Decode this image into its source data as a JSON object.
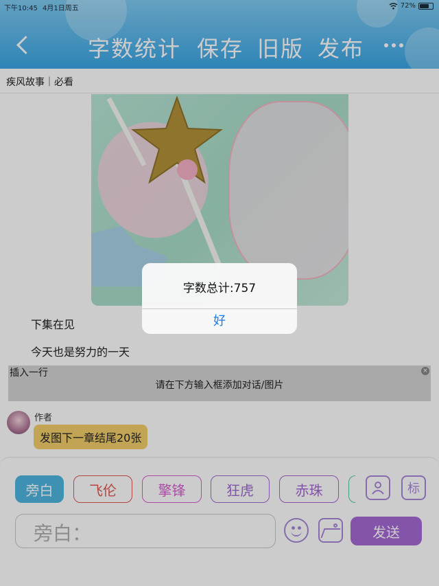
{
  "status_bar": {
    "time": "下午10:45",
    "date": "4月1日周五",
    "battery": "72%",
    "battery_level": 0.72
  },
  "nav": {
    "back_icon": "chevron-left-icon",
    "items": [
      {
        "label": "字数统计"
      },
      {
        "label": "保存"
      },
      {
        "label": "旧版"
      },
      {
        "label": "发布"
      }
    ],
    "more_icon": "ellipsis-icon"
  },
  "story": {
    "title": "疾风故事｜必看"
  },
  "content": {
    "lines": [
      "下集在见",
      "今天也是努力的一天"
    ],
    "insert": {
      "label": "插入一行",
      "hint": "请在下方输入框添加对话/图片",
      "close": "×"
    },
    "message": {
      "author": "作者",
      "text": "发图下一章结尾20张"
    }
  },
  "characters": [
    {
      "label": "旁白",
      "color": "#4fb6e0",
      "selected": true
    },
    {
      "label": "飞伦",
      "color": "#e0584e",
      "selected": false
    },
    {
      "label": "擎锋",
      "color": "#d65ed0",
      "selected": false
    },
    {
      "label": "狂虎",
      "color": "#9f6ad4",
      "selected": false
    },
    {
      "label": "赤珠",
      "color": "#a267d2",
      "selected": false
    }
  ],
  "toolbar": {
    "person_icon": "person-card-icon",
    "tag_label": "标",
    "emoji_icon": "smiley-icon",
    "image_icon": "image-icon",
    "send": "发送"
  },
  "input": {
    "placeholder": "旁白："
  },
  "dialog": {
    "message": "字数总计:757",
    "ok": "好"
  },
  "colors": {
    "header": "#3aa6e6",
    "accent": "#a56ad6",
    "bubble": "#f2cf6b",
    "dialog_button": "#1a7be6"
  }
}
